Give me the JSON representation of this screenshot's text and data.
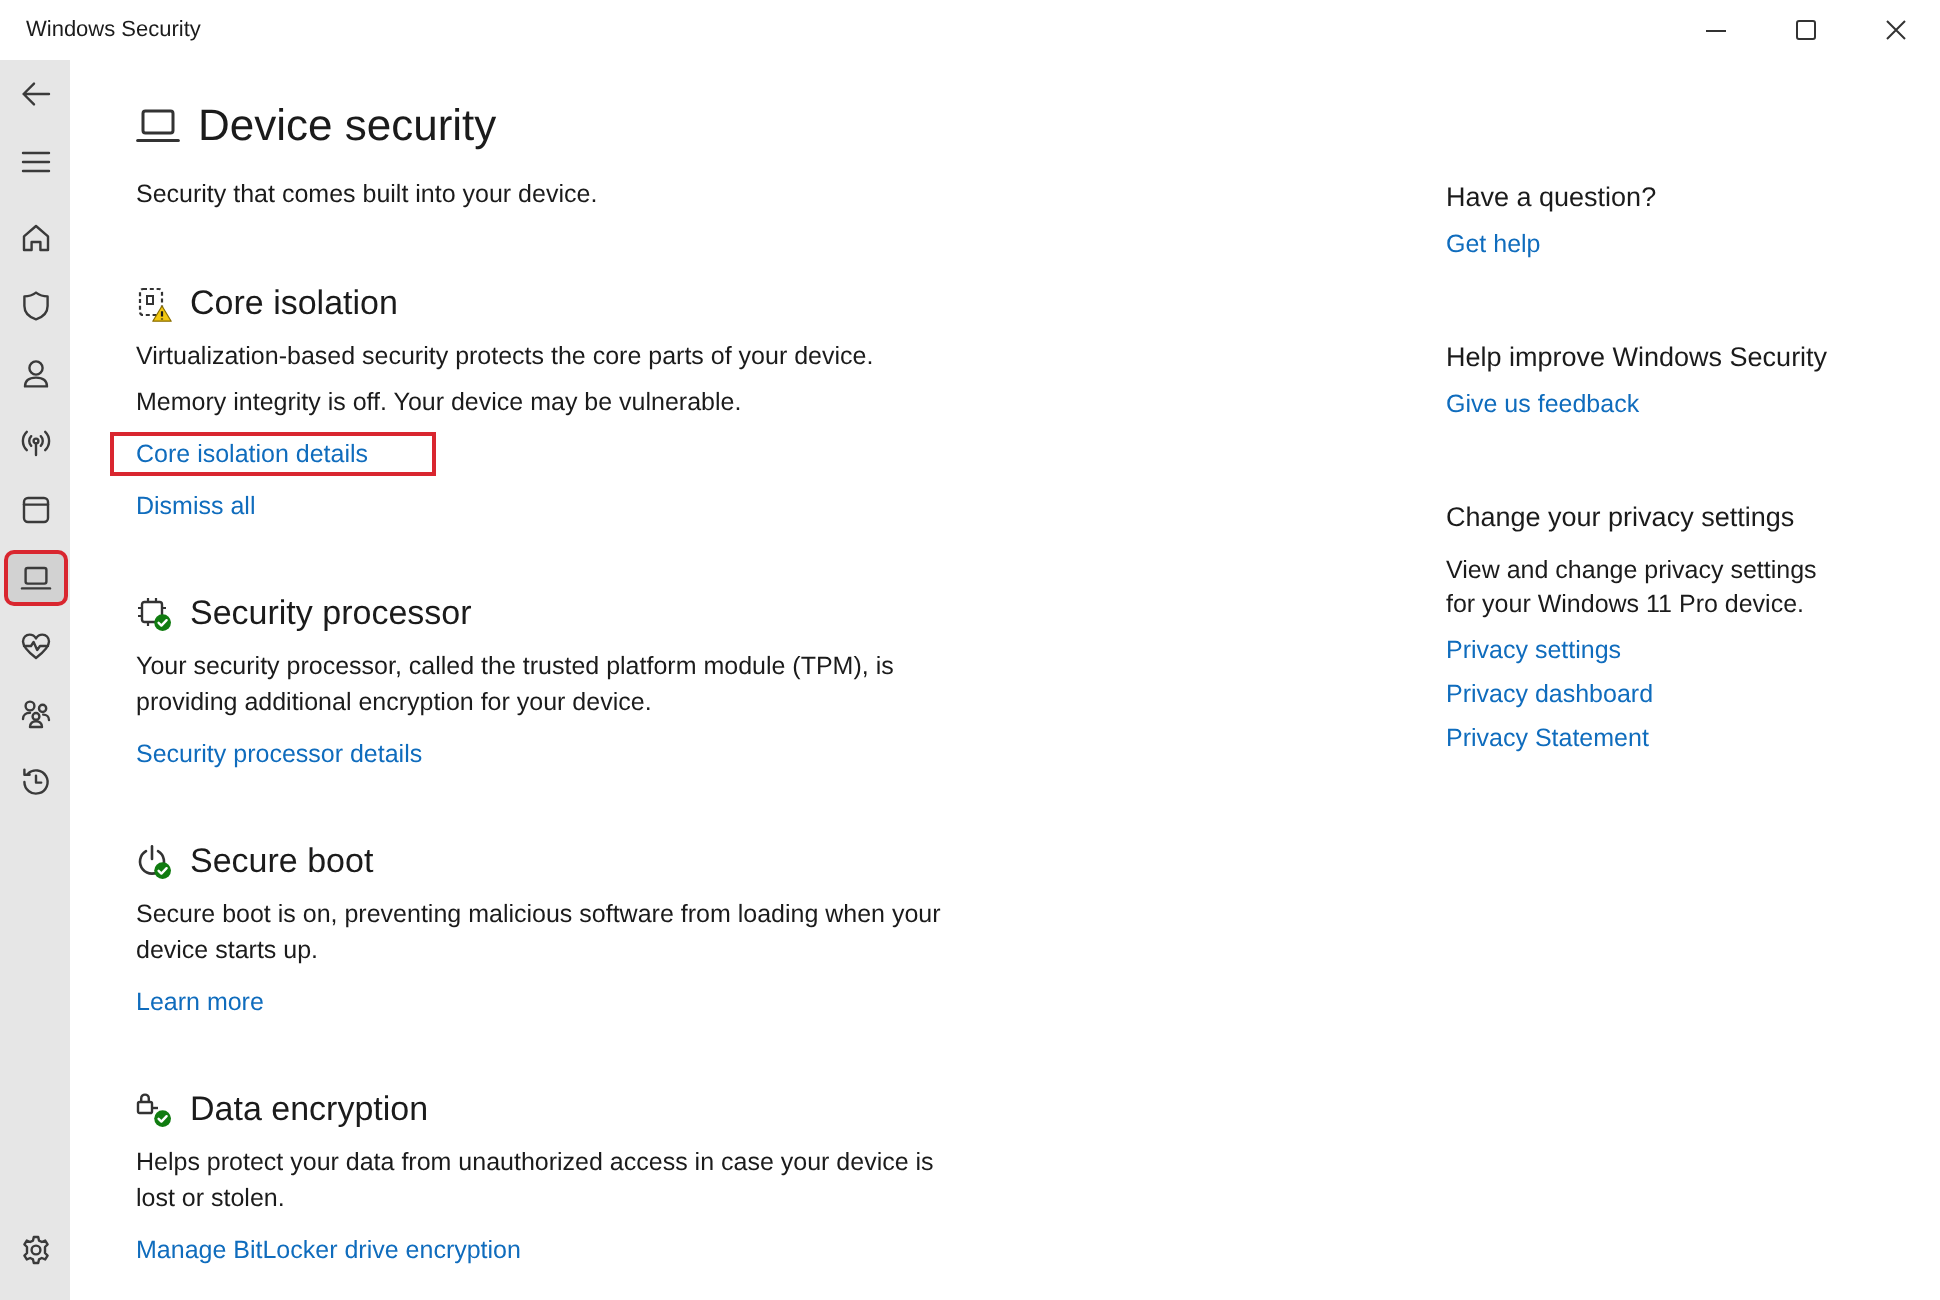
{
  "window": {
    "title": "Windows Security"
  },
  "sidebar": {
    "nav_items": [
      {
        "selected": false,
        "highlighted": false
      },
      {
        "selected": false,
        "highlighted": false
      },
      {
        "selected": false,
        "highlighted": false
      },
      {
        "selected": false,
        "highlighted": false
      },
      {
        "selected": false,
        "highlighted": false
      },
      {
        "selected": true,
        "highlighted": true
      },
      {
        "selected": false,
        "highlighted": false
      },
      {
        "selected": false,
        "highlighted": false
      },
      {
        "selected": false,
        "highlighted": false
      }
    ]
  },
  "page": {
    "title": "Device security",
    "subtitle": "Security that comes built into your device."
  },
  "sections": [
    {
      "warning": true,
      "title": "Core isolation",
      "paragraphs": [
        "Virtualization-based security protects the core parts of your device.",
        "Memory integrity is off. Your device may be vulnerable."
      ],
      "links": [
        {
          "text": "Core isolation details",
          "highlighted": true
        },
        {
          "text": "Dismiss all",
          "highlighted": false
        }
      ]
    },
    {
      "warning": false,
      "title": "Security processor",
      "paragraphs": [
        "Your security processor, called the trusted platform module (TPM), is providing additional encryption for your device."
      ],
      "links": [
        {
          "text": "Security processor details",
          "highlighted": false
        }
      ]
    },
    {
      "warning": false,
      "title": "Secure boot",
      "paragraphs": [
        "Secure boot is on, preventing malicious software from loading when your device starts up."
      ],
      "links": [
        {
          "text": "Learn more",
          "highlighted": false
        }
      ]
    },
    {
      "warning": false,
      "title": "Data encryption",
      "paragraphs": [
        "Helps protect your data from unauthorized access in case your device is lost or stolen."
      ],
      "links": [
        {
          "text": "Manage BitLocker drive encryption",
          "highlighted": false
        }
      ]
    }
  ],
  "side_panel": [
    {
      "heading": "Have a question?",
      "links": [
        "Get help"
      ]
    },
    {
      "heading": "Help improve Windows Security",
      "links": [
        "Give us feedback"
      ]
    },
    {
      "heading": "Change your privacy settings",
      "text": "View and change privacy settings for your Windows 11 Pro device.",
      "links": [
        "Privacy settings",
        "Privacy dashboard",
        "Privacy Statement"
      ]
    }
  ]
}
